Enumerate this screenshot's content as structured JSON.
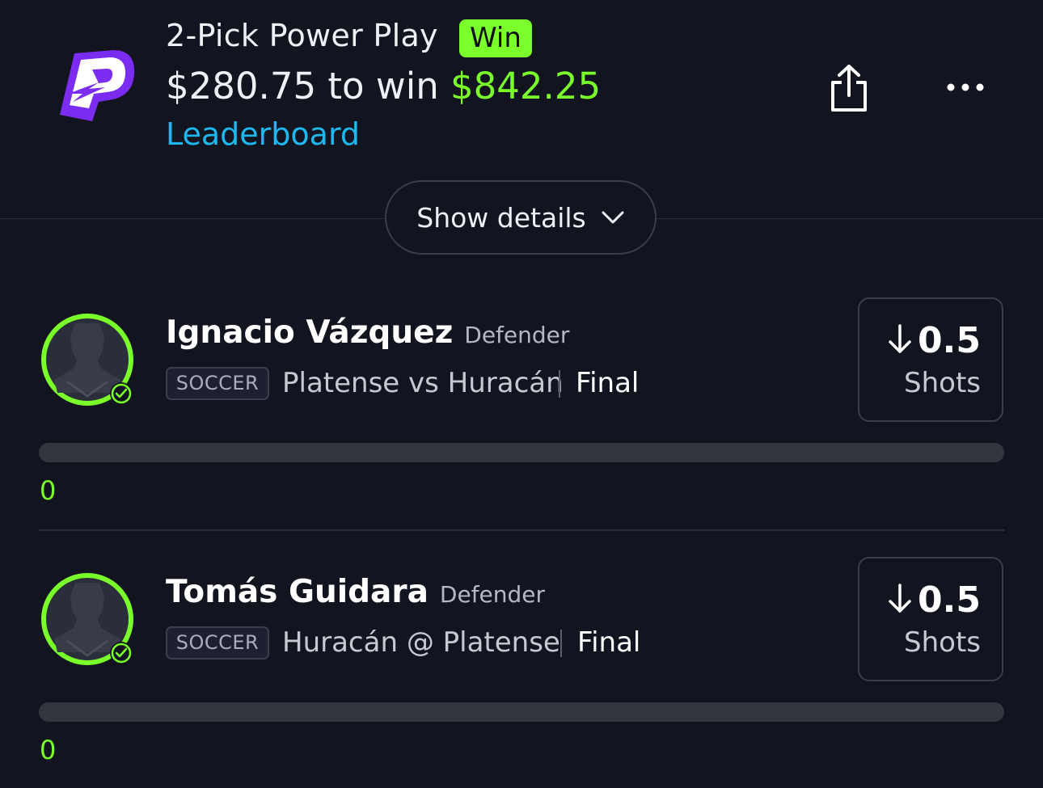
{
  "header": {
    "logo": "prizepicks-logo",
    "title": "2-Pick Power Play",
    "result_badge": "Win",
    "entry_amount": "$280.75",
    "to_win_text": "to win",
    "payout_amount": "$842.25",
    "leaderboard_link": "Leaderboard",
    "share_icon": "share-icon",
    "more_icon": "more-options-icon"
  },
  "details_toggle": {
    "label": "Show details",
    "icon": "chevron-down-icon"
  },
  "colors": {
    "accent_green": "#7aff2a",
    "link_blue": "#1eb8f0",
    "background": "#12141f",
    "brand_purple": "#7a2cf0"
  },
  "picks": [
    {
      "player_name": "Ignacio Vázquez",
      "position": "Defender",
      "sport": "SOCCER",
      "matchup": "Platense vs Huracán",
      "status": "Final",
      "direction": "lower",
      "line": "0.5",
      "stat_type": "Shots",
      "actual": "0",
      "progress": 0,
      "avatar_status": "check-circle-icon"
    },
    {
      "player_name": "Tomás Guidara",
      "position": "Defender",
      "sport": "SOCCER",
      "matchup": "Huracán @ Platense",
      "status": "Final",
      "direction": "lower",
      "line": "0.5",
      "stat_type": "Shots",
      "actual": "0",
      "progress": 0,
      "avatar_status": "check-circle-icon"
    }
  ]
}
